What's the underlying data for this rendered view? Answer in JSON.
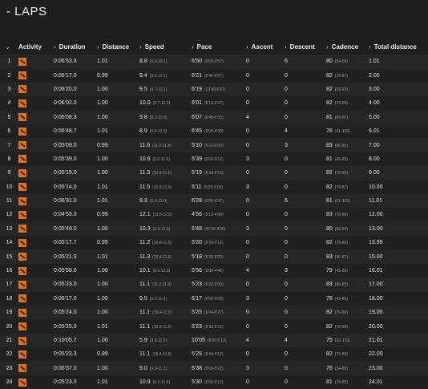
{
  "page": {
    "title": "- LAPS"
  },
  "columns": [
    "Activity",
    "Duration",
    "Distance",
    "Speed",
    "Pace",
    "Ascent",
    "Descent",
    "Cadence",
    "Total distance"
  ],
  "icons": {
    "sort": "chevron-down-icon",
    "col": "chevron-right-icon",
    "activity": "orange-activity-icon",
    "color": "#e3711a"
  },
  "laps": [
    {
      "n": "1",
      "duration": "0:06'53.3",
      "distance": "1.01",
      "speed": "8.8",
      "speed_range": "(0.0-10.1)",
      "pace": "6'50",
      "pace_range": "(0'00-0'57)",
      "ascent": "0",
      "descent": "6",
      "cadence": "80",
      "cadence_range": "(54-96)",
      "total": "1.01"
    },
    {
      "n": "2",
      "duration": "0:06'17.0",
      "distance": "0.99",
      "speed": "9.4",
      "speed_range": "(9.0-10.1)",
      "pace": "6'21",
      "pace_range": "(5'40-6'57)",
      "ascent": "0",
      "descent": "0",
      "cadence": "82",
      "cadence_range": "(78-87)",
      "total": "2.00"
    },
    {
      "n": "3",
      "duration": "0:06'20.0",
      "distance": "1.00",
      "speed": "9.5",
      "speed_range": "(4.7-10.1)",
      "pace": "6'19",
      "pace_range": "(12'49-6'57)",
      "ascent": "0",
      "descent": "0",
      "cadence": "82",
      "cadence_range": "(53-93)",
      "total": "3.00"
    },
    {
      "n": "4",
      "duration": "0:06'02.0",
      "distance": "1.00",
      "speed": "10.0",
      "speed_range": "(9.7-10.1)",
      "pace": "6'01",
      "pace_range": "(6'10-5'57)",
      "ascent": "0",
      "descent": "0",
      "cadence": "82",
      "cadence_range": "(79-85)",
      "total": "4.00"
    },
    {
      "n": "5",
      "duration": "0:06'08.3",
      "distance": "1.00",
      "speed": "9.8",
      "speed_range": "(8.1-10.8)",
      "pace": "6'07",
      "pace_range": "(6'48-5'33)",
      "ascent": "4",
      "descent": "0",
      "cadence": "81",
      "cadence_range": "(60-87)",
      "total": "5.00"
    },
    {
      "n": "6",
      "duration": "0:06'48.7",
      "distance": "1.01",
      "speed": "8.9",
      "speed_range": "(0.0-12.8)",
      "pace": "6'45",
      "pace_range": "(0'00-4'49)",
      "ascent": "0",
      "descent": "4",
      "cadence": "78",
      "cadence_range": "(41-100)",
      "total": "6.01"
    },
    {
      "n": "7",
      "duration": "0:05'09.0",
      "distance": "0.99",
      "speed": "11.6",
      "speed_range": "(11.2-11.9)",
      "pace": "5'10",
      "pace_range": "(5'22-5'03)",
      "ascent": "0",
      "descent": "3",
      "cadence": "83",
      "cadence_range": "(80-85)",
      "total": "7.00"
    },
    {
      "n": "8",
      "duration": "0:05'39.0",
      "distance": "1.00",
      "speed": "10.6",
      "speed_range": "(0.0-11.5)",
      "pace": "5'39",
      "pace_range": "(0'00-5'12)",
      "ascent": "3",
      "descent": "0",
      "cadence": "81",
      "cadence_range": "(49-85)",
      "total": "8.00"
    },
    {
      "n": "9",
      "duration": "0:05'19.0",
      "distance": "1.00",
      "speed": "11.3",
      "speed_range": "(10.8-11.5)",
      "pace": "5'19",
      "pace_range": "(5'33-5'12)",
      "ascent": "0",
      "descent": "0",
      "cadence": "82",
      "cadence_range": "(79-85)",
      "total": "9.00"
    },
    {
      "n": "10",
      "duration": "0:05'14.0",
      "distance": "1.01",
      "speed": "11.5",
      "speed_range": "(10.8-11.9)",
      "pace": "5'11",
      "pace_range": "(5'33-5'03)",
      "ascent": "3",
      "descent": "0",
      "cadence": "82",
      "cadence_range": "(79-87)",
      "total": "10.00"
    },
    {
      "n": "11",
      "duration": "0:06'31.0",
      "distance": "1.01",
      "speed": "9.3",
      "speed_range": "(0.0-13.0)",
      "pace": "6'28",
      "pace_range": "(0'00-4'37)",
      "ascent": "0",
      "descent": "6",
      "cadence": "81",
      "cadence_range": "(51-105)",
      "total": "11.01"
    },
    {
      "n": "12",
      "duration": "0:04'53.0",
      "distance": "0.99",
      "speed": "12.1",
      "speed_range": "(11.5-12.8)",
      "pace": "4'56",
      "pace_range": "(5'12-4'49)",
      "ascent": "0",
      "descent": "0",
      "cadence": "83",
      "cadence_range": "(78-86)",
      "total": "12.00"
    },
    {
      "n": "13",
      "duration": "0:05'49.0",
      "distance": "1.00",
      "speed": "10.3",
      "speed_range": "(1.4-12.8)",
      "pace": "5'48",
      "pace_range": "(41'40-4'45)",
      "ascent": "3",
      "descent": "0",
      "cadence": "80",
      "cadence_range": "(50-84)",
      "total": "13.00"
    },
    {
      "n": "14",
      "duration": "0:05'17.7",
      "distance": "0.99",
      "speed": "11.2",
      "speed_range": "(10.8-11.5)",
      "pace": "5'20",
      "pace_range": "(5'33-5'12)",
      "ascent": "0",
      "descent": "0",
      "cadence": "82",
      "cadence_range": "(78-85)",
      "total": "13.99"
    },
    {
      "n": "15",
      "duration": "0:05'21.3",
      "speed": "11.3",
      "speed_range": "(10.8-11.9)",
      "distance": "1.01",
      "pace": "5'18",
      "pace_range": "(5'33-5'03)",
      "ascent": "0",
      "descent": "0",
      "cadence": "83",
      "cadence_range": "(80-87)",
      "total": "15.00"
    },
    {
      "n": "16",
      "duration": "0:05'58.0",
      "distance": "1.00",
      "speed": "10.1",
      "speed_range": "(0.0-12.8)",
      "pace": "5'56",
      "pace_range": "(0'00-4'45)",
      "ascent": "4",
      "descent": "3",
      "cadence": "79",
      "cadence_range": "(45-86)",
      "total": "16.01"
    },
    {
      "n": "17",
      "duration": "0:05'23.0",
      "distance": "1.00",
      "speed": "11.1",
      "speed_range": "(11.2-11.9)",
      "pace": "5'23",
      "pace_range": "(5'22-5'03)",
      "ascent": "0",
      "descent": "0",
      "cadence": "83",
      "cadence_range": "(80-85)",
      "total": "17.00"
    },
    {
      "n": "18",
      "duration": "0:06'17.0",
      "distance": "1.00",
      "speed": "9.5",
      "speed_range": "(0.0-11.9)",
      "pace": "6'17",
      "pace_range": "(0'00-5'03)",
      "ascent": "3",
      "descent": "0",
      "cadence": "78",
      "cadence_range": "(43-85)",
      "total": "18.00"
    },
    {
      "n": "19",
      "duration": "0:05'24.0",
      "distance": "1.00",
      "speed": "11.1",
      "speed_range": "(10.4-11.2)",
      "pace": "5'25",
      "pace_range": "(5'44-5'22)",
      "ascent": "0",
      "descent": "0",
      "cadence": "82",
      "cadence_range": "(79-86)",
      "total": "19.00"
    },
    {
      "n": "20",
      "duration": "0:05'25.0",
      "distance": "1.01",
      "speed": "11.1",
      "speed_range": "(10.8-11.9)",
      "pace": "5'23",
      "pace_range": "(5'33-5'12)",
      "ascent": "0",
      "descent": "0",
      "cadence": "82",
      "cadence_range": "(78-86)",
      "total": "20.00"
    },
    {
      "n": "21",
      "duration": "0:10'05.7",
      "distance": "1.00",
      "speed": "5.9",
      "speed_range": "(0.0-11.5)",
      "pace": "10'05",
      "pace_range": "(0'00-5'12)",
      "ascent": "4",
      "descent": "4",
      "cadence": "75",
      "cadence_range": "(32-170)",
      "total": "21.01"
    },
    {
      "n": "22",
      "duration": "0:05'23.3",
      "distance": "0.99",
      "speed": "11.1",
      "speed_range": "(10.4-11.5)",
      "pace": "5'25",
      "pace_range": "(5'44-5'12)",
      "ascent": "0",
      "descent": "0",
      "cadence": "82",
      "cadence_range": "(79-86)",
      "total": "22.00"
    },
    {
      "n": "23",
      "duration": "0:06'37.0",
      "distance": "1.00",
      "speed": "9.0",
      "speed_range": "(0.0-11.2)",
      "pace": "6'38",
      "pace_range": "(0'00-5'22)",
      "ascent": "3",
      "descent": "0",
      "cadence": "76",
      "cadence_range": "(34-85)",
      "total": "23.00"
    },
    {
      "n": "24",
      "duration": "0:05'23.0",
      "distance": "1.01",
      "speed": "10.9",
      "speed_range": "(0.0-11.5)",
      "pace": "5'30",
      "pace_range": "(0'00-5'12)",
      "ascent": "0",
      "descent": "0",
      "cadence": "81",
      "cadence_range": "(78-85)",
      "total": "24.01"
    }
  ]
}
